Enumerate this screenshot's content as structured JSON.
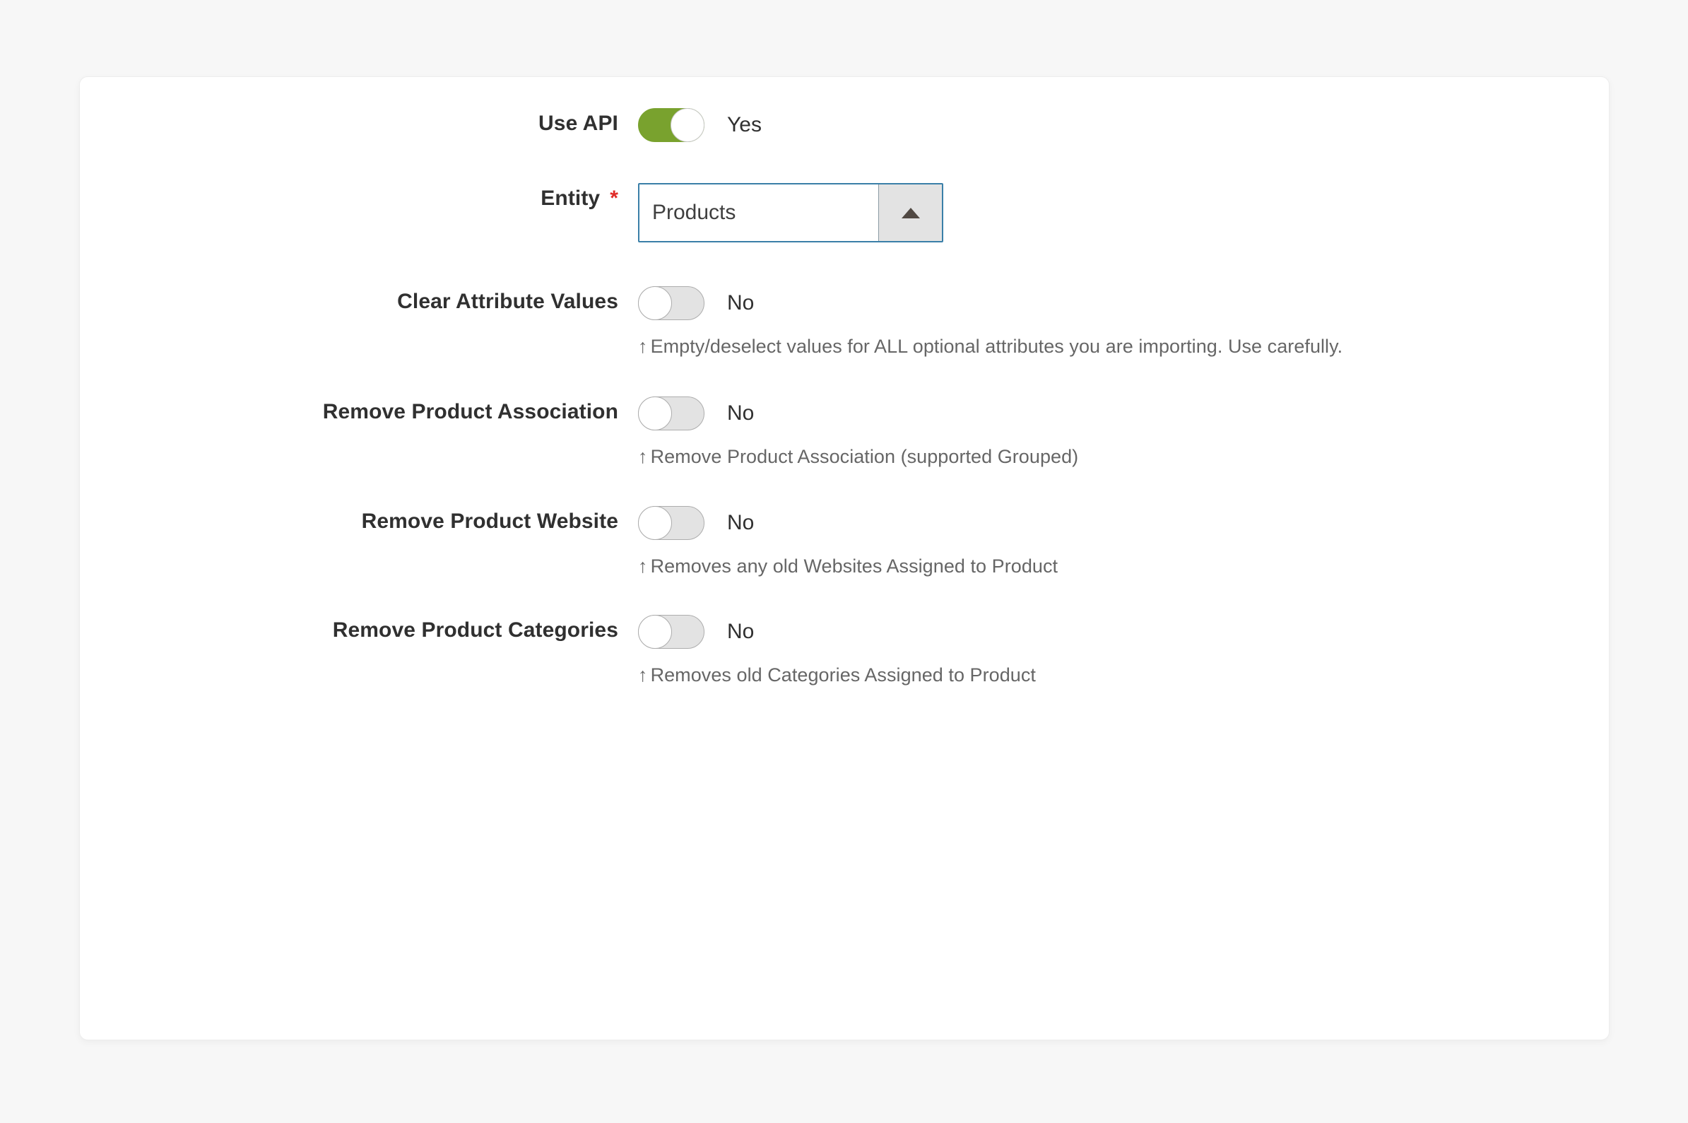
{
  "theme": {
    "page_background": "#f7f7f7",
    "card_background": "#ffffff",
    "label_color": "#303030",
    "note_color": "#666666",
    "toggle_on_color": "#79a22e",
    "toggle_off_color": "#e3e3e3",
    "required_marker_color": "#e02b27",
    "select_border_color": "#3a7fa8"
  },
  "form": {
    "fields": [
      {
        "key": "use_api",
        "label": "Use API",
        "type": "toggle",
        "state": "on",
        "state_label": "Yes",
        "required": false,
        "note": ""
      },
      {
        "key": "entity",
        "label": "Entity",
        "type": "select",
        "required": true,
        "required_marker": "*",
        "value": "Products",
        "caret": "caret-up",
        "note": ""
      },
      {
        "key": "clear_attribute_values",
        "label": "Clear Attribute Values",
        "type": "toggle",
        "state": "off",
        "state_label": "No",
        "required": false,
        "note_arrow": "↑",
        "note": "Empty/deselect values for ALL optional attributes you are importing. Use carefully."
      },
      {
        "key": "remove_product_association",
        "label": "Remove Product Association",
        "type": "toggle",
        "state": "off",
        "state_label": "No",
        "required": false,
        "note_arrow": "↑",
        "note": "Remove Product Association (supported Grouped)"
      },
      {
        "key": "remove_product_website",
        "label": "Remove Product Website",
        "type": "toggle",
        "state": "off",
        "state_label": "No",
        "required": false,
        "note_arrow": "↑",
        "note": "Removes any old Websites Assigned to Product"
      },
      {
        "key": "remove_product_categories",
        "label": "Remove Product Categories",
        "type": "toggle",
        "state": "off",
        "state_label": "No",
        "required": false,
        "note_arrow": "↑",
        "note": "Removes old Categories Assigned to Product"
      }
    ]
  }
}
